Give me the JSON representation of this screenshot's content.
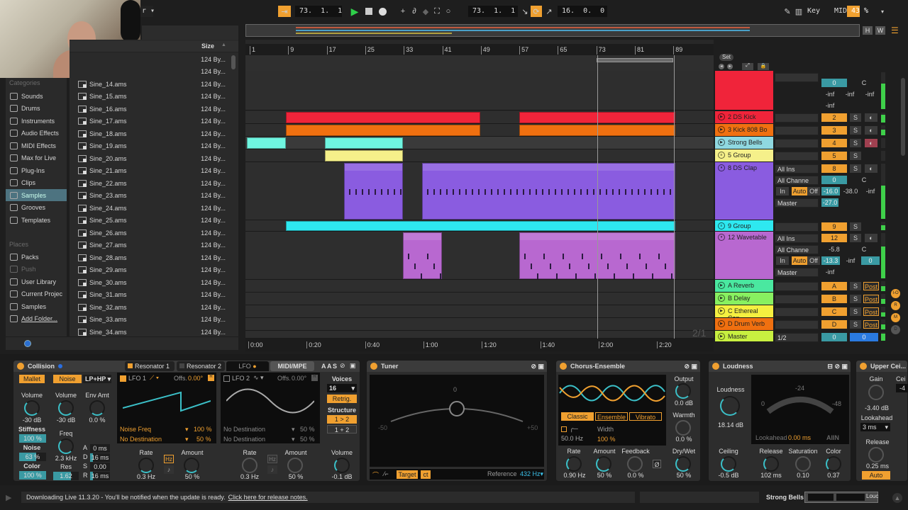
{
  "topbar": {
    "arrangement_position": "73.  1.  1",
    "loop_start": "73.  1.  1",
    "loop_length": "16.  0.  0",
    "key_label": "Key",
    "midi_label": "MIDI",
    "cpu_load": "43 %",
    "icons": [
      "follow-icon",
      "play-icon",
      "stop-icon",
      "record-icon",
      "overdub-icon",
      "automation-arm-icon",
      "reenable-automation-icon",
      "capture-icon",
      "session-record-icon",
      "punch-in-icon",
      "loop-icon",
      "punch-out-icon",
      "draw-mode-icon",
      "computer-keyboard-icon"
    ],
    "overview_buttons": [
      "H",
      "W"
    ]
  },
  "browser": {
    "size_header": "Size",
    "categories_label": "Categories",
    "categories": [
      {
        "label": "Sounds",
        "icon": "sounds-icon"
      },
      {
        "label": "Drums",
        "icon": "drums-icon"
      },
      {
        "label": "Instruments",
        "icon": "instruments-icon"
      },
      {
        "label": "Audio Effects",
        "icon": "audio-effects-icon"
      },
      {
        "label": "MIDI Effects",
        "icon": "midi-effects-icon"
      },
      {
        "label": "Max for Live",
        "icon": "max-for-live-icon"
      },
      {
        "label": "Plug-Ins",
        "icon": "plugins-icon"
      },
      {
        "label": "Clips",
        "icon": "clips-icon"
      },
      {
        "label": "Samples",
        "icon": "samples-icon",
        "selected": true
      },
      {
        "label": "Grooves",
        "icon": "grooves-icon"
      },
      {
        "label": "Templates",
        "icon": "templates-icon"
      }
    ],
    "places_label": "Places",
    "places": [
      {
        "label": "Packs",
        "icon": "packs-icon"
      },
      {
        "label": "Push",
        "icon": "push-icon",
        "dim": true
      },
      {
        "label": "User Library",
        "icon": "user-library-icon"
      },
      {
        "label": "Current Projec",
        "icon": "current-project-icon"
      },
      {
        "label": "Samples",
        "icon": "folder-icon"
      },
      {
        "label": "Add Folder...",
        "icon": "add-folder-icon"
      }
    ],
    "files_top_sizes": [
      "124 By...",
      "124 By..."
    ],
    "files": [
      {
        "name": "Sine_14.ams",
        "size": "124 By..."
      },
      {
        "name": "Sine_15.ams",
        "size": "124 By..."
      },
      {
        "name": "Sine_16.ams",
        "size": "124 By..."
      },
      {
        "name": "Sine_17.ams",
        "size": "124 By..."
      },
      {
        "name": "Sine_18.ams",
        "size": "124 By..."
      },
      {
        "name": "Sine_19.ams",
        "size": "124 By..."
      },
      {
        "name": "Sine_20.ams",
        "size": "124 By..."
      },
      {
        "name": "Sine_21.ams",
        "size": "124 By..."
      },
      {
        "name": "Sine_22.ams",
        "size": "124 By..."
      },
      {
        "name": "Sine_23.ams",
        "size": "124 By..."
      },
      {
        "name": "Sine_24.ams",
        "size": "124 By..."
      },
      {
        "name": "Sine_25.ams",
        "size": "124 By..."
      },
      {
        "name": "Sine_26.ams",
        "size": "124 By..."
      },
      {
        "name": "Sine_27.ams",
        "size": "124 By..."
      },
      {
        "name": "Sine_28.ams",
        "size": "124 By..."
      },
      {
        "name": "Sine_29.ams",
        "size": "124 By..."
      },
      {
        "name": "Sine_30.ams",
        "size": "124 By..."
      },
      {
        "name": "Sine_31.ams",
        "size": "124 By..."
      },
      {
        "name": "Sine_32.ams",
        "size": "124 By..."
      },
      {
        "name": "Sine_33.ams",
        "size": "124 By..."
      },
      {
        "name": "Sine_34.ams",
        "size": "124 By..."
      }
    ]
  },
  "arrangement": {
    "bar_ruler": [
      "1",
      "9",
      "17",
      "25",
      "33",
      "41",
      "49",
      "57",
      "65",
      "73",
      "81",
      "89"
    ],
    "time_ruler": [
      "0:00",
      "0:20",
      "0:40",
      "1:00",
      "1:20",
      "1:40",
      "2:00",
      "2:20"
    ],
    "zoom_ratio": "2/1",
    "loop_bars": [
      73,
      89
    ],
    "set_label": "Set",
    "colors": {
      "red": "#f0243a",
      "orange": "#f07010",
      "aqua": "#6ff5e0",
      "yellow": "#f5f08a",
      "violet": "#8a5ce0",
      "cyan": "#2ee8f0",
      "lilac": "#b868d0"
    }
  },
  "tracks": [
    {
      "name": "",
      "color": "#f0243a",
      "num": "0",
      "pan": "C",
      "vals": [
        "-inf",
        "-inf",
        "-inf",
        "-inf"
      ]
    },
    {
      "name": "2 DS Kick",
      "color": "#f0243a",
      "num": "2",
      "solo": "S"
    },
    {
      "name": "3 Kick 808 Bo",
      "color": "#f07010",
      "num": "3",
      "solo": "S"
    },
    {
      "name": "Strong Bells",
      "color": "#8fd8e0",
      "num": "4",
      "solo": "S"
    },
    {
      "name": "5 Group",
      "color": "#f5f08a",
      "num": "5",
      "solo": "S"
    },
    {
      "name": "8 DS Clap",
      "color": "#8a5ce0",
      "num": "8",
      "solo": "S",
      "input": "All Ins",
      "channel": "All Channe",
      "monitor": [
        "In",
        "Auto",
        "Off"
      ],
      "output": "Master",
      "vol": "0",
      "pan": "C",
      "sends": [
        "-16.0",
        "-38.0",
        "-inf"
      ],
      "peak": "-27.0"
    },
    {
      "name": "9 Group",
      "color": "#2ee8f0",
      "num": "9",
      "solo": "S"
    },
    {
      "name": "12 Wavetable",
      "color": "#b868d0",
      "num": "12",
      "solo": "S",
      "input": "All Ins",
      "channel": "All Channe",
      "monitor": [
        "In",
        "Auto",
        "Off"
      ],
      "output": "Master",
      "vol": "-5.8",
      "pan": "C",
      "sends": [
        "-13.3",
        "-inf",
        "0"
      ],
      "peak": "-inf"
    },
    {
      "name": "A Reverb",
      "color": "#4ae8a0",
      "num": "A",
      "solo": "S",
      "post": "Post"
    },
    {
      "name": "B Delay",
      "color": "#88f060",
      "num": "B",
      "solo": "S",
      "post": "Post"
    },
    {
      "name": "C Ethereal Can",
      "color": "#f5f040",
      "num": "C",
      "solo": "S",
      "post": "Post"
    },
    {
      "name": "D Drum Verb",
      "color": "#f07010",
      "num": "D",
      "solo": "S",
      "post": "Post"
    },
    {
      "name": "Master",
      "color": "#c8f040",
      "num": "0",
      "output": "1/2",
      "cue": "0"
    }
  ],
  "mixer_side_buttons": [
    "I-O",
    "R",
    "M",
    "D"
  ],
  "devices": {
    "collision": {
      "title": "Collision",
      "tabs": [
        "Resonator 1",
        "Resonator 2",
        "LFO",
        "MIDI/MPE"
      ],
      "mallet": "Mallet",
      "noise": "Noise",
      "filter": "LP+HP",
      "mallet_volume": {
        "label": "Volume",
        "value": "-30 dB"
      },
      "stiffness": {
        "label": "Stiffness",
        "value": "100 %",
        "fill": 1.0
      },
      "mallet_noise": {
        "label": "Noise",
        "value": "63 %",
        "fill": 0.63
      },
      "color": {
        "label": "Color",
        "value": "100 %",
        "fill": 1.0
      },
      "noise_volume": {
        "label": "Volume",
        "value": "-30 dB"
      },
      "env_amt": {
        "label": "Env Amt",
        "value": "0.0 %"
      },
      "freq": {
        "label": "Freq",
        "value": "2.3 kHz"
      },
      "res": {
        "label": "Res",
        "value": "1.62",
        "fill": 0.7
      },
      "adsr": [
        {
          "k": "A",
          "v": "0 ms"
        },
        {
          "k": "D",
          "v": "16 ms"
        },
        {
          "k": "S",
          "v": "0.00"
        },
        {
          "k": "R",
          "v": "16 ms"
        }
      ],
      "lfo1": {
        "label": "LFO 1",
        "offset_label": "Offs.",
        "offset": "0.00°",
        "dest1": "Noise Freq",
        "amt1": "100 %",
        "dest2": "No Destination",
        "amt2": "50 %",
        "rate_label": "Rate",
        "rate": "0.3 Hz",
        "hz": "Hz",
        "amount_label": "Amount",
        "amount": "50 %"
      },
      "lfo2": {
        "label": "LFO 2",
        "offset_label": "Offs.",
        "offset": "0.00°",
        "dest1": "No Destination",
        "amt1": "50 %",
        "dest2": "No Destination",
        "amt2": "50 %",
        "rate_label": "Rate",
        "rate": "0.3 Hz",
        "hz": "Hz",
        "amount_label": "Amount",
        "amount": "50 %"
      },
      "voices_label": "Voices",
      "voices": "16",
      "retrig": "Retrig.",
      "structure_label": "Structure",
      "structure_a": "1 > 2",
      "structure_b": "1 + 2",
      "volume_label": "Volume",
      "volume": "-0.1 dB",
      "header_buttons": [
        "A",
        "A",
        "S"
      ]
    },
    "tuner": {
      "title": "Tuner",
      "zero": "0",
      "minus": "-50",
      "plus": "+50",
      "target": "Target",
      "ct": "ct",
      "reference_label": "Reference",
      "reference": "432 Hz"
    },
    "chorus": {
      "title": "Chorus-Ensemble",
      "modes": [
        "Classic",
        "Ensemble",
        "Vibrato"
      ],
      "hp_freq": "50.0 Hz",
      "width_label": "Width",
      "width": "100 %",
      "output_label": "Output",
      "output": "0.0 dB",
      "warmth_label": "Warmth",
      "warmth": "0.0 %",
      "rate_label": "Rate",
      "rate": "0.90 Hz",
      "amount_label": "Amount",
      "amount": "50 %",
      "feedback_label": "Feedback",
      "feedback": "0.0 %",
      "drywet_label": "Dry/Wet",
      "drywet": "50 %",
      "invert": "Ø"
    },
    "loudness": {
      "title": "Loudness",
      "loudness_label": "Loudness",
      "loudness": "18.14 dB",
      "meter_marks": [
        "0",
        "-24",
        "-48"
      ],
      "lookahead_label": "Lookahead",
      "lookahead": "0.00 ms",
      "brand": "AIIN",
      "ceiling_label": "Ceiling",
      "ceiling": "-0.5 dB",
      "release_label": "Release",
      "release": "102 ms",
      "saturation_label": "Saturation",
      "saturation": "0.10",
      "color_label": "Color",
      "color": "0.37"
    },
    "upper_ceiling": {
      "title": "Upper Cei...",
      "gain_label": "Gain",
      "gain": "-3.40 dB",
      "ceiling_label": "Cei",
      "ceiling": "-4",
      "lookahead_label": "Lookahead",
      "lookahead": "3 ms",
      "release_label": "Release",
      "release": "0.25 ms",
      "auto": "Auto"
    }
  },
  "statusbar": {
    "message": "Downloading Live 11.3.20 - You'll be notified when the update is ready.",
    "link": "Click here for release notes.",
    "selected_track": "Strong Bells",
    "device_chain_label": "Louc"
  }
}
